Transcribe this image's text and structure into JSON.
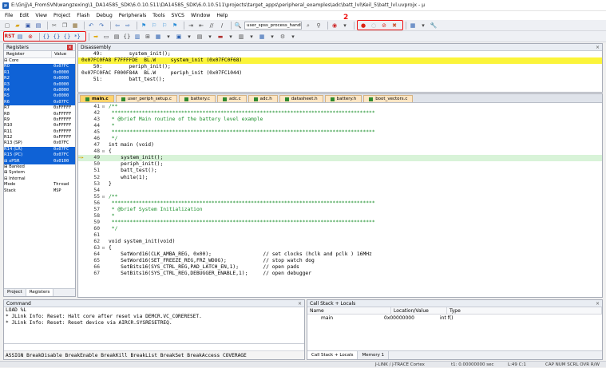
{
  "window": {
    "title": "E:\\Gnjj\\4_FromSVN\\wangzexing\\1_DA14585_SDK\\6.0.10.511\\DA14585_SDK\\6.0.10.511\\projects\\target_apps\\peripheral_examples\\adc\\batt_lvl\\Keil_5\\batt_lvl.uvprojx - µ"
  },
  "menu": [
    "File",
    "Edit",
    "View",
    "Project",
    "Flash",
    "Debug",
    "Peripherals",
    "Tools",
    "SVCS",
    "Window",
    "Help"
  ],
  "toolbar": {
    "target_combo": "user_spss_process_handl",
    "annotation": "2"
  },
  "registers": {
    "title": "Registers",
    "col_register": "Register",
    "col_value": "Value",
    "rows": [
      {
        "name": "⊟ Core",
        "value": "",
        "sel": false
      },
      {
        "name": "    R0",
        "value": "0x07FC",
        "sel": true
      },
      {
        "name": "    R1",
        "value": "0x0000",
        "sel": true
      },
      {
        "name": "    R2",
        "value": "0x0000",
        "sel": true
      },
      {
        "name": "    R3",
        "value": "0x0000",
        "sel": true
      },
      {
        "name": "    R4",
        "value": "0x0000",
        "sel": true
      },
      {
        "name": "    R5",
        "value": "0x0000",
        "sel": true
      },
      {
        "name": "    R6",
        "value": "0x07FC",
        "sel": true
      },
      {
        "name": "    R7",
        "value": "0xFFFFF",
        "sel": false
      },
      {
        "name": "    R8",
        "value": "0xFFFFF",
        "sel": false
      },
      {
        "name": "    R9",
        "value": "0xFFFFF",
        "sel": false
      },
      {
        "name": "    R10",
        "value": "0xFFFFF",
        "sel": false
      },
      {
        "name": "    R11",
        "value": "0xFFFFF",
        "sel": false
      },
      {
        "name": "    R12",
        "value": "0xFFFFF",
        "sel": false
      },
      {
        "name": "    R13 (SP)",
        "value": "0x07FC",
        "sel": false
      },
      {
        "name": "    R14 (LR)",
        "value": "0x07FC",
        "sel": true
      },
      {
        "name": "    R15 (PC)",
        "value": "0x07FC",
        "sel": true
      },
      {
        "name": "  ⊞ xPSR",
        "value": "0x0100",
        "sel": true
      },
      {
        "name": "⊞ Banked",
        "value": "",
        "sel": false
      },
      {
        "name": "⊞ System",
        "value": "",
        "sel": false
      },
      {
        "name": "⊟ Internal",
        "value": "",
        "sel": false
      },
      {
        "name": "     Mode",
        "value": "Thread",
        "sel": false
      },
      {
        "name": "     Stack",
        "value": "MSP",
        "sel": false
      }
    ],
    "tabs": [
      "Project",
      "Registers"
    ]
  },
  "disassembly": {
    "title": "Disassembly",
    "lines": [
      {
        "text": "    49:         system_init();",
        "hl": false
      },
      {
        "text": "0x07FC0FA8 F7FFFFDE  BL.W     system_init (0x07FC0F68)",
        "hl": true
      },
      {
        "text": "    50:         periph_init();",
        "hl": false
      },
      {
        "text": "0x07FC0FAC F000F84A  BL.W     periph_init (0x07FC1044)",
        "hl": false
      },
      {
        "text": "    51:         batt_test();",
        "hl": false
      }
    ]
  },
  "editor": {
    "tabs": [
      "main.c",
      "user_periph_setup.c",
      "battery.c",
      "adc.c",
      "adc.h",
      "datasheet.h",
      "battery.h",
      "boot_vectors.c"
    ],
    "lines": [
      {
        "n": "41",
        "f": "⊟",
        "t": "/**",
        "cls": "c-com"
      },
      {
        "n": "42",
        "f": "",
        "t": " ***************************************************************************************",
        "cls": "c-com"
      },
      {
        "n": "43",
        "f": "",
        "t": " * @brief Main routine of the battery level example",
        "cls": "c-com"
      },
      {
        "n": "44",
        "f": "",
        "t": " *",
        "cls": "c-com"
      },
      {
        "n": "45",
        "f": "",
        "t": " ***************************************************************************************",
        "cls": "c-com"
      },
      {
        "n": "46",
        "f": "",
        "t": " */",
        "cls": "c-com"
      },
      {
        "n": "47",
        "f": "",
        "t": "int main (void)",
        "cls": ""
      },
      {
        "n": "48",
        "f": "⊟",
        "t": "{",
        "cls": ""
      },
      {
        "n": "49",
        "f": "",
        "t": "    system_init();",
        "cls": "",
        "cur": true
      },
      {
        "n": "50",
        "f": "",
        "t": "    periph_init();",
        "cls": ""
      },
      {
        "n": "51",
        "f": "",
        "t": "    batt_test();",
        "cls": ""
      },
      {
        "n": "52",
        "f": "",
        "t": "    while(1);",
        "cls": ""
      },
      {
        "n": "53",
        "f": "",
        "t": "}",
        "cls": ""
      },
      {
        "n": "54",
        "f": "",
        "t": "",
        "cls": ""
      },
      {
        "n": "55",
        "f": "⊟",
        "t": "/**",
        "cls": "c-com"
      },
      {
        "n": "56",
        "f": "",
        "t": " ***************************************************************************************",
        "cls": "c-com"
      },
      {
        "n": "57",
        "f": "",
        "t": " * @brief System Initialization",
        "cls": "c-com"
      },
      {
        "n": "58",
        "f": "",
        "t": " *",
        "cls": "c-com"
      },
      {
        "n": "59",
        "f": "",
        "t": " ***************************************************************************************",
        "cls": "c-com"
      },
      {
        "n": "60",
        "f": "",
        "t": " */",
        "cls": "c-com"
      },
      {
        "n": "61",
        "f": "",
        "t": "",
        "cls": ""
      },
      {
        "n": "62",
        "f": "",
        "t": "void system_init(void)",
        "cls": ""
      },
      {
        "n": "63",
        "f": "⊟",
        "t": "{",
        "cls": ""
      },
      {
        "n": "64",
        "f": "",
        "t": "    SetWord16(CLK_AMBA_REG, 0x00);                 // set clocks (hclk and pclk ) 16MHz",
        "cls": ""
      },
      {
        "n": "65",
        "f": "",
        "t": "    SetWord16(SET_FREEZE_REG,FRZ_WDOG);            // stop watch dog",
        "cls": ""
      },
      {
        "n": "66",
        "f": "",
        "t": "    SetBits16(SYS_CTRL_REG,PAD_LATCH_EN,1);        // open pads",
        "cls": ""
      },
      {
        "n": "67",
        "f": "",
        "t": "    SetBits16(SYS_CTRL_REG,DEBUGGER_ENABLE,1);     // open debugger",
        "cls": ""
      }
    ],
    "exec_arrow": "⇒▸"
  },
  "command": {
    "title": "Command",
    "lines": [
      "LOAD %L",
      "* JLink Info: Reset: Halt core after reset via DEMCR.VC_CORERESET.",
      "* JLink Info: Reset: Reset device via AIRCR.SYSRESETREQ."
    ],
    "hint": "ASSIGN BreakDisable BreakEnable BreakKill BreakList BreakSet BreakAccess COVERAGE"
  },
  "callstack": {
    "title": "Call Stack + Locals",
    "col_name": "Name",
    "col_location": "Location/Value",
    "col_type": "Type",
    "rows": [
      {
        "name": "main",
        "location": "0x00000000",
        "type": "int f()"
      }
    ],
    "tabs": [
      "Call Stack + Locals",
      "Memory 1"
    ]
  },
  "status": {
    "debugger": "J-LINK / J-TRACE Cortex",
    "time": "t1: 0.00000000 sec",
    "position": "L:49 C:1",
    "flags": "CAP NUM SCRL OVR R/W"
  },
  "colors": {
    "highlight": "#fbf43a",
    "selection": "#0f62d6",
    "annotation": "#ee1111"
  }
}
